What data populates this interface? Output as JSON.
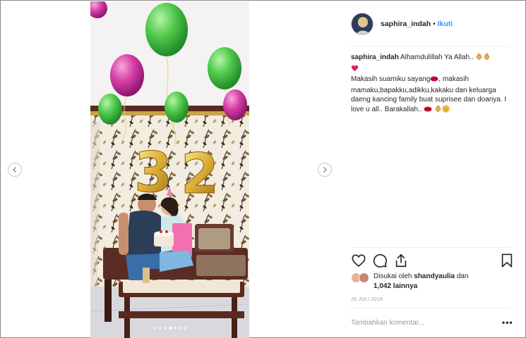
{
  "post": {
    "username": "saphira_indah",
    "follow_label": "Ikuti",
    "separator": "•",
    "caption": {
      "username": "saphira_indah",
      "line1": "Alhamdulillah Ya Allah..",
      "line2": "Makasih suamiku sayang",
      "line3": ", makasih mamaku,bapakku,adikku,kakaku dan keluarga daeng kancing family buat suprisee dan doanya. I love u all.. Barakallah.."
    },
    "likes": {
      "prefix": "Disukai oleh",
      "user": "shandyaulia",
      "connector": "dan",
      "count": "1,042 lainnya"
    },
    "date": "26 JULI 2018",
    "comment_placeholder": "Tambahkan komentar...",
    "more_label": "•••",
    "carousel": {
      "total": 7,
      "active_index": 3
    }
  },
  "icons": {
    "prev": "chevron-left-icon",
    "next": "chevron-right-icon",
    "like": "heart-icon",
    "comment": "comment-icon",
    "share": "share-icon",
    "save": "bookmark-icon"
  },
  "colors": {
    "link": "#3897f0",
    "text": "#262626",
    "muted": "#999999",
    "divider": "#efefef"
  }
}
